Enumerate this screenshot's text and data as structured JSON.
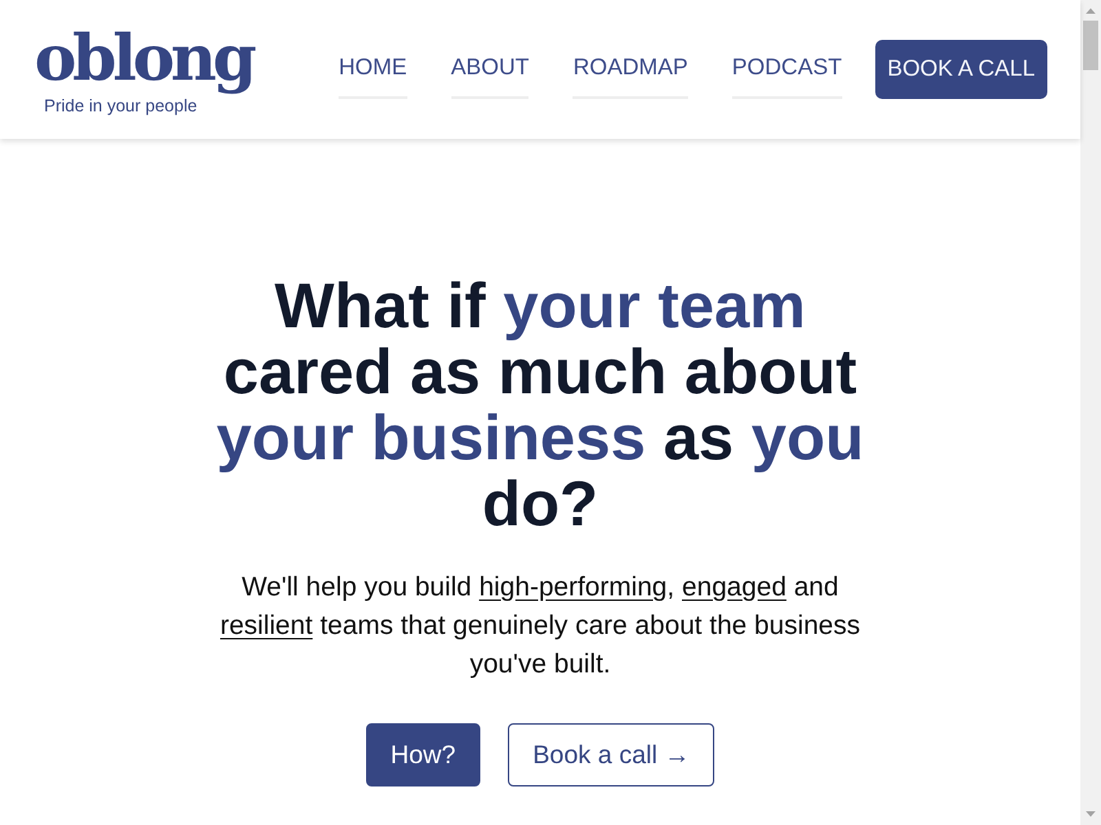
{
  "header": {
    "logo": {
      "wordmark": "oblong",
      "tagline": "Pride in your people"
    },
    "nav": [
      {
        "label": "HOME"
      },
      {
        "label": "ABOUT"
      },
      {
        "label": "ROADMAP"
      },
      {
        "label": "PODCAST"
      }
    ],
    "cta": {
      "label": "BOOK A CALL"
    }
  },
  "hero": {
    "headline": [
      {
        "text": "What if ",
        "highlight": false
      },
      {
        "text": "your team",
        "highlight": true
      },
      {
        "text": " cared as much about ",
        "highlight": false
      },
      {
        "text": "your business",
        "highlight": true
      },
      {
        "text": " as ",
        "highlight": false
      },
      {
        "text": "you",
        "highlight": true
      },
      {
        "text": " do?",
        "highlight": false
      }
    ],
    "description": [
      {
        "text": "We'll help you build ",
        "underlined": false
      },
      {
        "text": "high-performing",
        "underlined": true
      },
      {
        "text": ", ",
        "underlined": false
      },
      {
        "text": "engaged",
        "underlined": true
      },
      {
        "text": " and ",
        "underlined": false
      },
      {
        "text": "resilient",
        "underlined": true
      },
      {
        "text": " teams that genuinely care about the business you've built.",
        "underlined": false
      }
    ],
    "buttons": [
      {
        "label": "How?",
        "kind": "primary"
      },
      {
        "label": "Book a call →",
        "kind": "outline"
      }
    ]
  }
}
